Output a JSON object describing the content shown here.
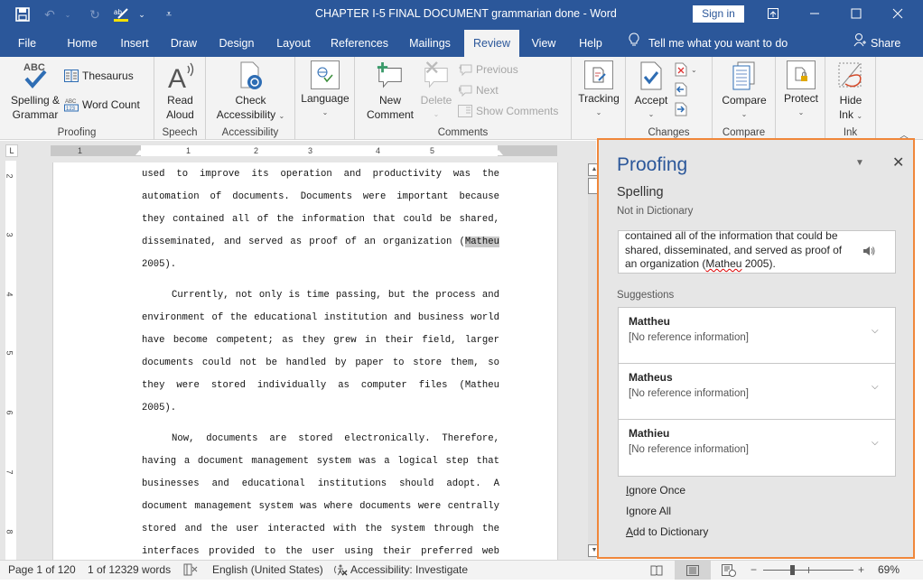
{
  "titlebar": {
    "title": "CHAPTER I-5 FINAL DOCUMENT  grammarian done  -  Word",
    "sign_in": "Sign in",
    "icons": [
      "save-icon",
      "undo-icon",
      "redo-icon",
      "highlight-spelling-icon",
      "customize-qat-icon"
    ],
    "window_controls": [
      "ribbon-display-options-icon",
      "minimize-icon",
      "maximize-icon",
      "close-icon"
    ]
  },
  "tabs": {
    "items": [
      "File",
      "Home",
      "Insert",
      "Draw",
      "Design",
      "Layout",
      "References",
      "Mailings",
      "Review",
      "View",
      "Help"
    ],
    "active": "Review",
    "tell_me": "Tell me what you want to do",
    "share": "Share"
  },
  "ribbon": {
    "groups": {
      "proofing": {
        "label": "Proofing",
        "spelling_line1": "Spelling &",
        "spelling_line2": "Grammar",
        "spelling_icon_text": "ABC",
        "thesaurus": "Thesaurus",
        "word_count": "Word Count"
      },
      "speech": {
        "label": "Speech",
        "read_line1": "Read",
        "read_line2": "Aloud"
      },
      "accessibility": {
        "label": "Accessibility",
        "check_line1": "Check",
        "check_line2": "Accessibility"
      },
      "language": {
        "label": "Language"
      },
      "comments": {
        "label": "Comments",
        "new_line1": "New",
        "new_line2": "Comment",
        "delete": "Delete",
        "previous": "Previous",
        "next": "Next",
        "show_comments": "Show Comments"
      },
      "tracking": {
        "label": "Tracking"
      },
      "changes": {
        "label": "Changes",
        "accept": "Accept"
      },
      "compare": {
        "label": "Compare",
        "compare": "Compare"
      },
      "protect": {
        "label": "Protect"
      },
      "ink": {
        "label": "Ink",
        "hide_line1": "Hide",
        "hide_line2": "Ink"
      }
    }
  },
  "ruler": {
    "h_numbers": [
      "1",
      "1",
      "2",
      "3",
      "4",
      "5"
    ],
    "v_numbers": [
      "2",
      "3",
      "4",
      "5",
      "6",
      "7",
      "8"
    ]
  },
  "document": {
    "paragraphs": [
      {
        "lines": [
          "used to improve its operation and productivity was the",
          "automation of documents. Documents were important because",
          "they contained all of the information that could be shared,",
          "disseminated, and served as proof of an organization (",
          "2005)."
        ],
        "highlight_word": "Matheu"
      },
      {
        "lines": [
          "Currently, not only is time passing, but the process and",
          "environment of the educational institution and business world",
          "have become competent; as they grew in their field, larger",
          "documents could not be handled by paper to store them, so",
          "they were stored individually as computer files (Matheu",
          "2005)."
        ]
      },
      {
        "lines": [
          "Now, documents are stored electronically. Therefore,",
          "having a document management system was a logical step that",
          "businesses and educational institutions should adopt. A",
          "document management system was where documents were centrally",
          "stored and the user interacted with the system through the",
          "interfaces provided to the user using their preferred web"
        ]
      }
    ]
  },
  "proofing_pane": {
    "title": "Proofing",
    "section": "Spelling",
    "subtitle": "Not in Dictionary",
    "context_line1": "contained all of the information that could be",
    "context_line2": "shared, disseminated, and served as proof of",
    "context_line3_pre": "an organization (",
    "context_word": "Matheu",
    "context_line3_post": " 2005).",
    "suggestions_label": "Suggestions",
    "suggestions": [
      {
        "word": "Mattheu",
        "ref": "[No reference information]"
      },
      {
        "word": "Matheus",
        "ref": "[No reference information]"
      },
      {
        "word": "Mathieu",
        "ref": "[No reference information]"
      }
    ],
    "actions": {
      "ignore_once_key": "I",
      "ignore_once_rest": "gnore Once",
      "ignore_all_pre": "I",
      "ignore_all_key": "g",
      "ignore_all_rest": "nore All",
      "add_key": "A",
      "add_rest": "dd to Dictionary"
    }
  },
  "statusbar": {
    "page": "Page 1 of 120",
    "words": "1 of 12329 words",
    "language": "English (United States)",
    "accessibility": "Accessibility: Investigate",
    "zoom_percent": "69%",
    "zoom_value": 69,
    "active_view": "print-layout"
  },
  "colors": {
    "brand": "#2b579a",
    "pane_highlight": "#f0873a"
  }
}
